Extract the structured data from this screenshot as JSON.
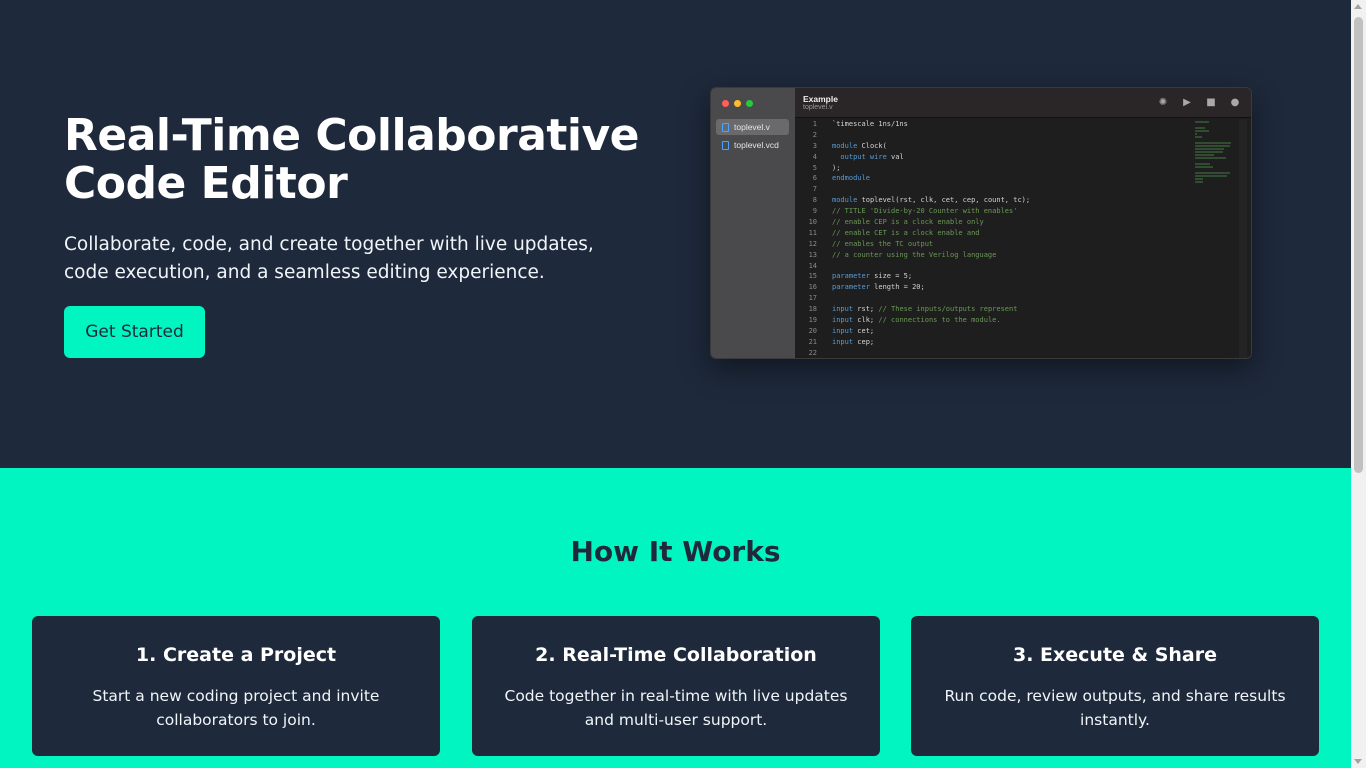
{
  "hero": {
    "title": "Real-Time Collaborative Code Editor",
    "subtitle": "Collaborate, code, and create together with live updates, code execution, and a seamless editing experience.",
    "cta_label": "Get Started"
  },
  "editor": {
    "title": "Example",
    "subtitle": "toplevel.v",
    "files": [
      {
        "name": "toplevel.v",
        "icon": "file-icon",
        "active": true
      },
      {
        "name": "toplevel.vcd",
        "icon": "file-icon",
        "active": false
      }
    ],
    "toolbar_icons": [
      "spinner-icon",
      "play-icon",
      "stop-icon",
      "info-icon"
    ],
    "code_lines": [
      {
        "n": "1",
        "segments": [
          {
            "t": "`timescale 1ns/1ns",
            "c": "plain"
          }
        ]
      },
      {
        "n": "2",
        "segments": []
      },
      {
        "n": "3",
        "segments": [
          {
            "t": "module",
            "c": "kw"
          },
          {
            "t": " Clock(",
            "c": "plain"
          }
        ]
      },
      {
        "n": "4",
        "segments": [
          {
            "t": "  output wire",
            "c": "kw"
          },
          {
            "t": " val",
            "c": "plain"
          }
        ]
      },
      {
        "n": "5",
        "segments": [
          {
            "t": ");",
            "c": "plain"
          }
        ]
      },
      {
        "n": "6",
        "segments": [
          {
            "t": "endmodule",
            "c": "kw"
          }
        ]
      },
      {
        "n": "7",
        "segments": []
      },
      {
        "n": "8",
        "segments": [
          {
            "t": "module",
            "c": "kw"
          },
          {
            "t": " toplevel(rst, clk, cet, cep, count, tc);",
            "c": "plain"
          }
        ]
      },
      {
        "n": "9",
        "segments": [
          {
            "t": "// TITLE 'Divide-by-20 Counter with enables'",
            "c": "cm"
          }
        ]
      },
      {
        "n": "10",
        "segments": [
          {
            "t": "// enable CEP is a clock enable only",
            "c": "cm"
          }
        ]
      },
      {
        "n": "11",
        "segments": [
          {
            "t": "// enable CET is a clock enable and",
            "c": "cm"
          }
        ]
      },
      {
        "n": "12",
        "segments": [
          {
            "t": "// enables the TC output",
            "c": "cm"
          }
        ]
      },
      {
        "n": "13",
        "segments": [
          {
            "t": "// a counter using the Verilog language",
            "c": "cm"
          }
        ]
      },
      {
        "n": "14",
        "segments": []
      },
      {
        "n": "15",
        "segments": [
          {
            "t": "parameter",
            "c": "kw"
          },
          {
            "t": " size = 5;",
            "c": "plain"
          }
        ]
      },
      {
        "n": "16",
        "segments": [
          {
            "t": "parameter",
            "c": "kw"
          },
          {
            "t": " length = 20;",
            "c": "plain"
          }
        ]
      },
      {
        "n": "17",
        "segments": []
      },
      {
        "n": "18",
        "segments": [
          {
            "t": "input",
            "c": "kw"
          },
          {
            "t": " rst; ",
            "c": "plain"
          },
          {
            "t": "// These inputs/outputs represent",
            "c": "cm"
          }
        ]
      },
      {
        "n": "19",
        "segments": [
          {
            "t": "input",
            "c": "kw"
          },
          {
            "t": " clk; ",
            "c": "plain"
          },
          {
            "t": "// connections to the module.",
            "c": "cm"
          }
        ]
      },
      {
        "n": "20",
        "segments": [
          {
            "t": "input",
            "c": "kw"
          },
          {
            "t": " cet;",
            "c": "plain"
          }
        ]
      },
      {
        "n": "21",
        "segments": [
          {
            "t": "input",
            "c": "kw"
          },
          {
            "t": " cep;",
            "c": "plain"
          }
        ]
      },
      {
        "n": "22",
        "segments": []
      }
    ]
  },
  "how": {
    "title": "How It Works",
    "cards": [
      {
        "title": "1. Create a Project",
        "text": "Start a new coding project and invite collaborators to join."
      },
      {
        "title": "2. Real-Time Collaboration",
        "text": "Code together in real-time with live updates and multi-user support."
      },
      {
        "title": "3. Execute & Share",
        "text": "Run code, review outputs, and share results instantly."
      }
    ]
  },
  "colors": {
    "hero_bg": "#1e293b",
    "accent": "#00f5c0",
    "card_bg": "#1e293b",
    "text_light": "#ffffff"
  }
}
